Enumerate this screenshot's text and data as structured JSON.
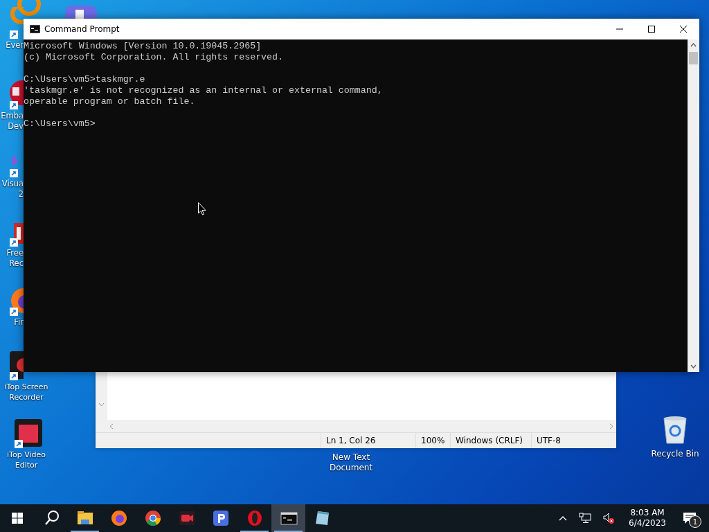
{
  "desktop_icons": [
    {
      "kind": "orange-ring",
      "label_lines": [
        "Ever"
      ]
    },
    {
      "kind": "red-badge",
      "label_lines": [
        "Emba",
        "Dev"
      ]
    },
    {
      "kind": "purple-logo",
      "label_lines": [
        "Visua",
        "2"
      ]
    },
    {
      "kind": "red-square",
      "label_lines": [
        "Free",
        "Rec"
      ]
    },
    {
      "kind": "firefox",
      "label_lines": [
        "Fir"
      ]
    },
    {
      "kind": "screen-recorder",
      "label_lines": [
        "iTop Screen",
        "Recorder"
      ]
    },
    {
      "kind": "video-editor",
      "label_lines": [
        "iTop Video",
        "Editor"
      ]
    }
  ],
  "notepad": {
    "status_bar": [
      "Ln 1, Col 26",
      "100%",
      "Windows (CRLF)",
      "UTF-8"
    ]
  },
  "notepad_file_icon": {
    "label_lines": [
      "New Text",
      "Document"
    ]
  },
  "recycle_bin": {
    "label": "Recycle Bin"
  },
  "command_prompt": {
    "title": "Command Prompt",
    "lines": [
      {
        "text": "Microsoft Windows [Version 10.0.19045.2965]",
        "gap_before": false
      },
      {
        "text": "(c) Microsoft Corporation. All rights reserved.",
        "gap_before": false
      },
      {
        "text": "C:\\Users\\vm5>taskmgr.e",
        "gap_before": true
      },
      {
        "text": "'taskmgr.e' is not recognized as an internal or external command,",
        "gap_before": false
      },
      {
        "text": "operable program or batch file.",
        "gap_before": false
      },
      {
        "text": "C:\\Users\\vm5>",
        "gap_before": true
      }
    ]
  },
  "taskbar": {
    "items": [
      {
        "kind": "start",
        "running": false,
        "selected": false
      },
      {
        "kind": "search",
        "running": false,
        "selected": false
      },
      {
        "kind": "explorer",
        "running": true,
        "selected": false
      },
      {
        "kind": "firefox",
        "running": false,
        "selected": false
      },
      {
        "kind": "chrome",
        "running": false,
        "selected": false
      },
      {
        "kind": "recorder",
        "running": false,
        "selected": false
      },
      {
        "kind": "p-app",
        "running": false,
        "selected": false
      },
      {
        "kind": "opera",
        "running": true,
        "selected": false
      },
      {
        "kind": "cmd",
        "running": true,
        "selected": true
      },
      {
        "kind": "notepad",
        "running": false,
        "selected": false
      }
    ],
    "clock": {
      "time": "8:03 AM",
      "date": "6/4/2023"
    },
    "notifications": {
      "count": "1"
    }
  }
}
